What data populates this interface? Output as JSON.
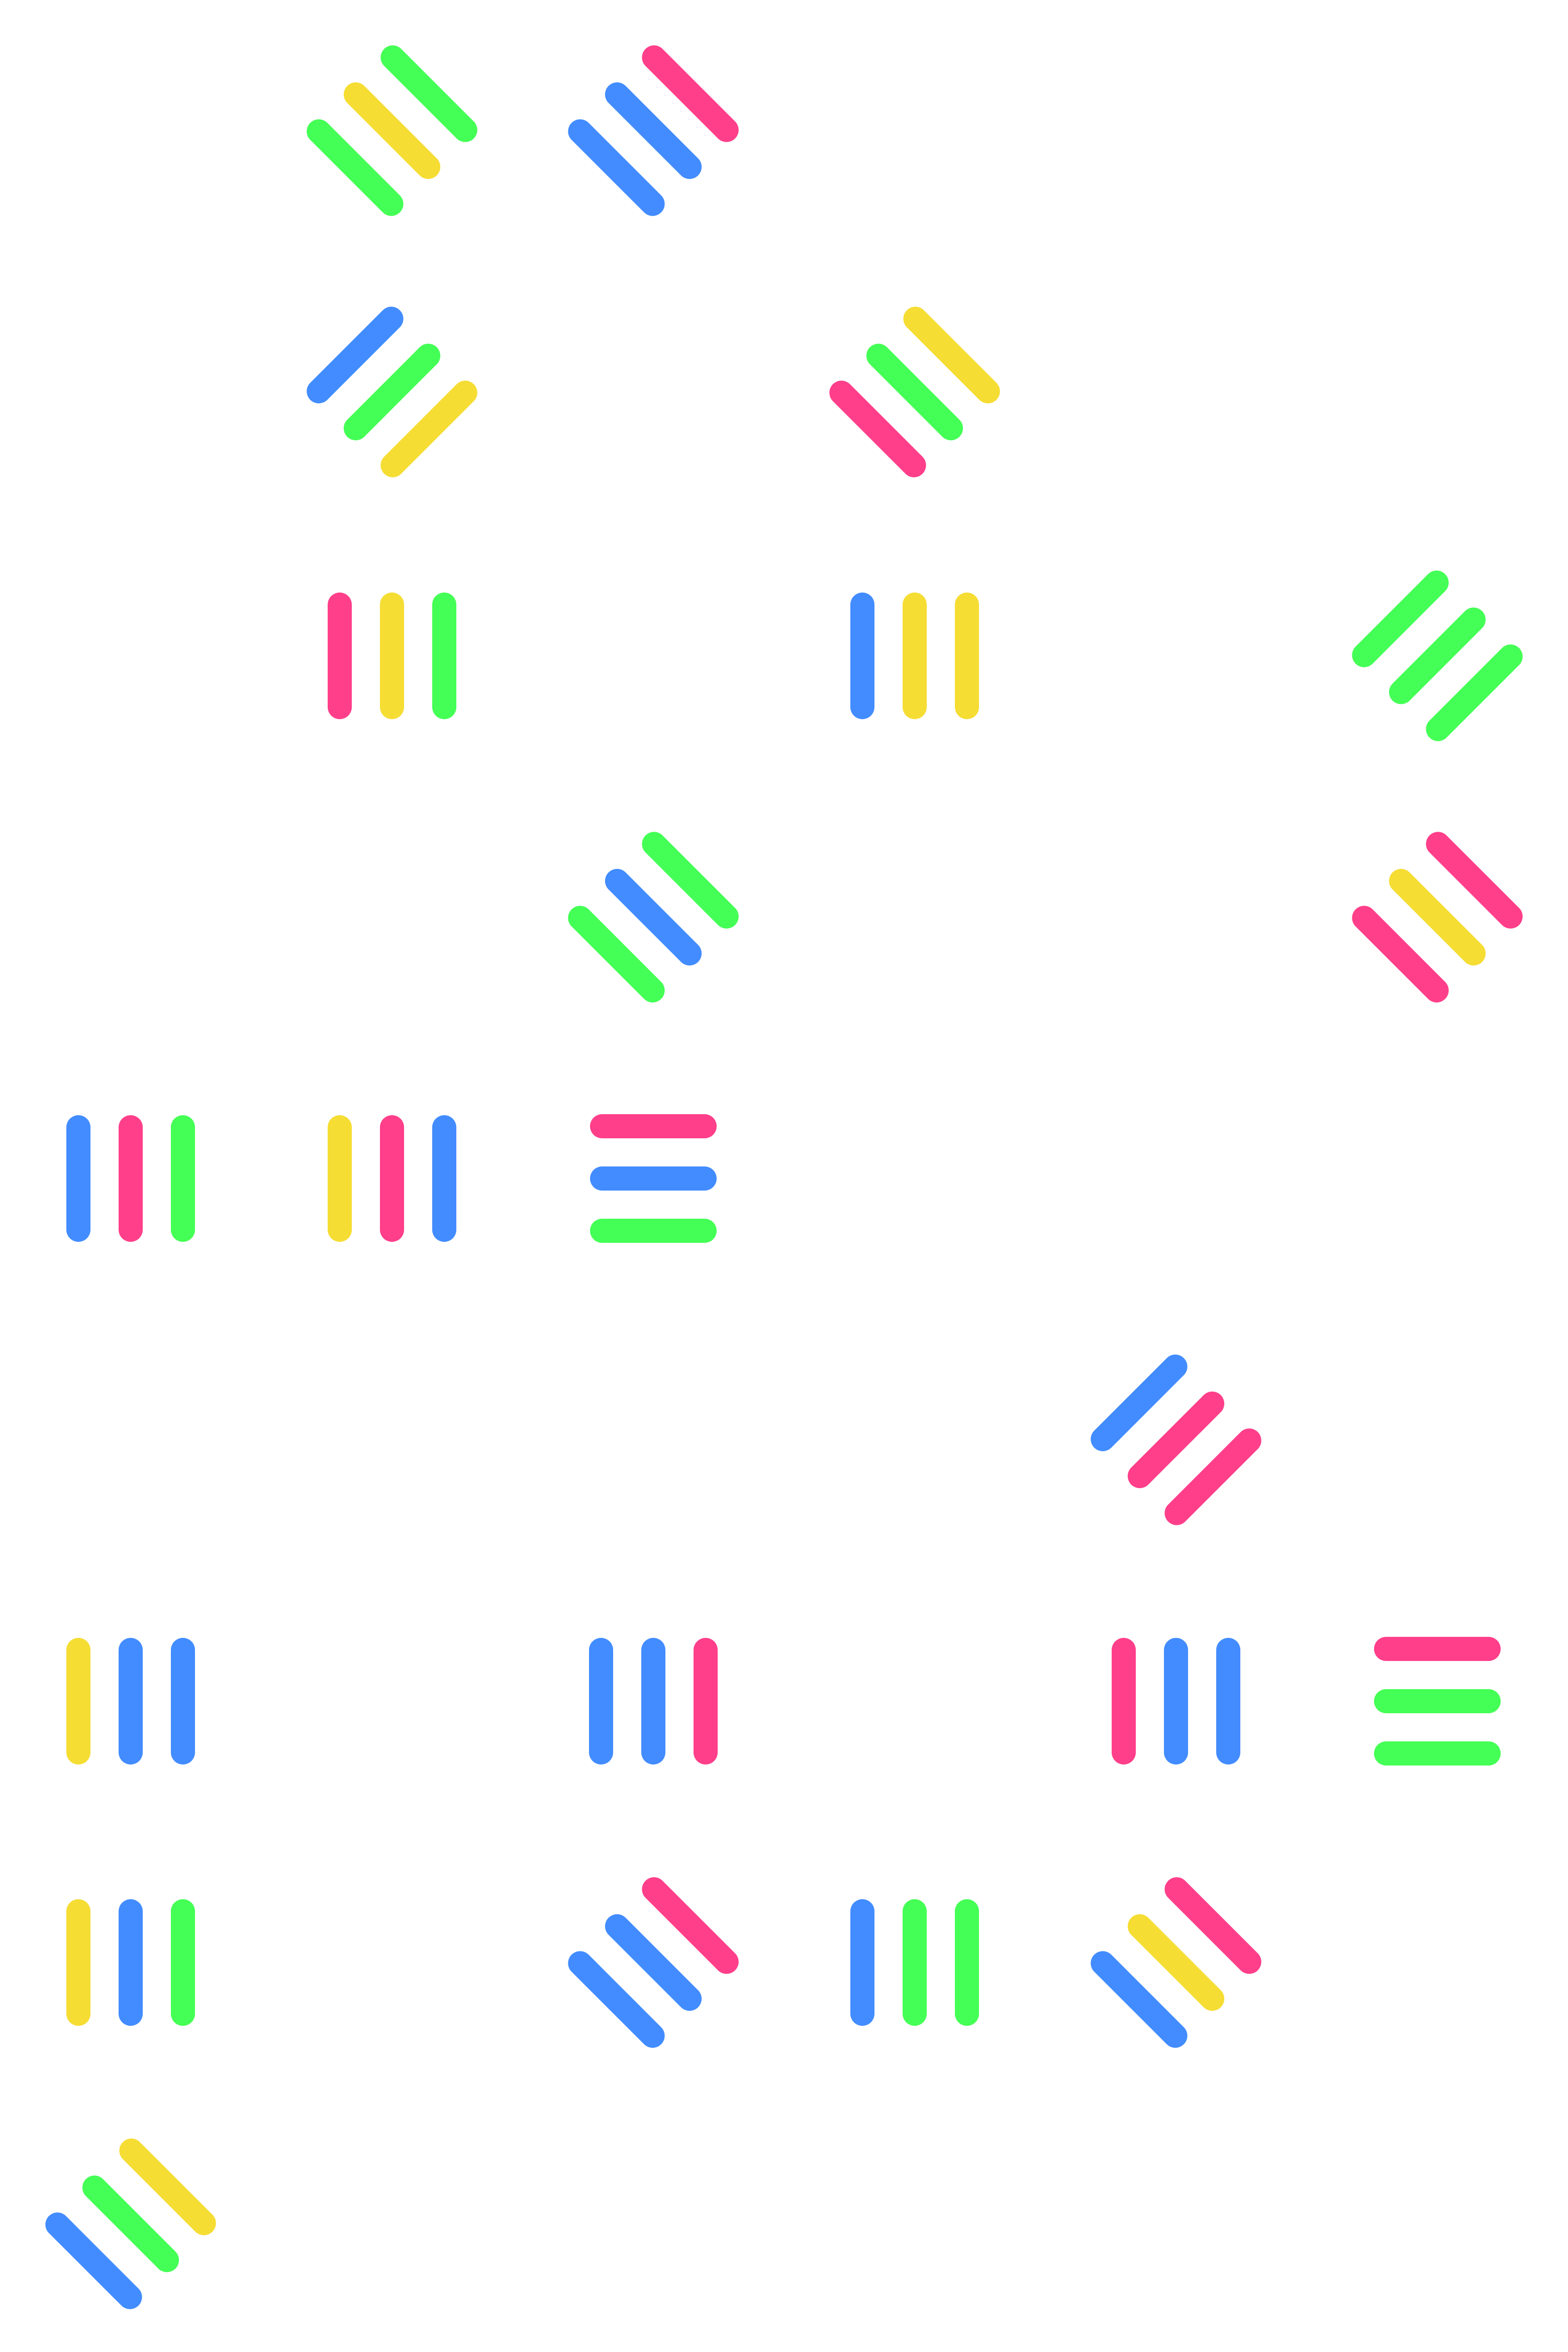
{
  "colors": {
    "pink": "#ff3f8a",
    "yellow": "#f5dd33",
    "green": "#44ff55",
    "blue": "#428cff"
  },
  "glyphs": [
    {
      "name": "glyph-r1c2",
      "orientation": "diagonal-down",
      "bars": [
        "green",
        "yellow",
        "green"
      ]
    },
    {
      "name": "glyph-r1c3",
      "orientation": "diagonal-down",
      "bars": [
        "blue",
        "blue",
        "pink"
      ]
    },
    {
      "name": "glyph-r2c2",
      "orientation": "diagonal-up",
      "bars": [
        "blue",
        "green",
        "yellow"
      ]
    },
    {
      "name": "glyph-r2c4",
      "orientation": "diagonal-down",
      "bars": [
        "pink",
        "green",
        "yellow"
      ]
    },
    {
      "name": "glyph-r3c2",
      "orientation": "vertical",
      "bars": [
        "pink",
        "yellow",
        "green"
      ]
    },
    {
      "name": "glyph-r3c4",
      "orientation": "vertical",
      "bars": [
        "blue",
        "yellow",
        "yellow"
      ]
    },
    {
      "name": "glyph-r3c6",
      "orientation": "diagonal-up",
      "bars": [
        "green",
        "green",
        "green"
      ]
    },
    {
      "name": "glyph-r4c3",
      "orientation": "diagonal-down",
      "bars": [
        "green",
        "blue",
        "green"
      ]
    },
    {
      "name": "glyph-r4c6",
      "orientation": "diagonal-down",
      "bars": [
        "pink",
        "yellow",
        "pink"
      ]
    },
    {
      "name": "glyph-r5c1",
      "orientation": "vertical",
      "bars": [
        "blue",
        "pink",
        "green"
      ]
    },
    {
      "name": "glyph-r5c2",
      "orientation": "vertical",
      "bars": [
        "yellow",
        "pink",
        "blue"
      ]
    },
    {
      "name": "glyph-r5c3",
      "orientation": "horizontal",
      "bars": [
        "pink",
        "blue",
        "green"
      ]
    },
    {
      "name": "glyph-r6c5",
      "orientation": "diagonal-up",
      "bars": [
        "blue",
        "pink",
        "pink"
      ]
    },
    {
      "name": "glyph-r7c1",
      "orientation": "vertical",
      "bars": [
        "yellow",
        "blue",
        "blue"
      ]
    },
    {
      "name": "glyph-r7c3",
      "orientation": "vertical",
      "bars": [
        "blue",
        "blue",
        "pink"
      ]
    },
    {
      "name": "glyph-r7c5",
      "orientation": "vertical",
      "bars": [
        "pink",
        "blue",
        "blue"
      ]
    },
    {
      "name": "glyph-r7c6",
      "orientation": "horizontal",
      "bars": [
        "pink",
        "green",
        "green"
      ]
    },
    {
      "name": "glyph-r8c1",
      "orientation": "vertical",
      "bars": [
        "yellow",
        "blue",
        "green"
      ]
    },
    {
      "name": "glyph-r8c3",
      "orientation": "diagonal-down",
      "bars": [
        "blue",
        "blue",
        "pink"
      ]
    },
    {
      "name": "glyph-r8c4",
      "orientation": "vertical",
      "bars": [
        "blue",
        "green",
        "green"
      ]
    },
    {
      "name": "glyph-r8c5",
      "orientation": "diagonal-down",
      "bars": [
        "blue",
        "yellow",
        "pink"
      ]
    },
    {
      "name": "glyph-r9c1",
      "orientation": "diagonal-down",
      "bars": [
        "blue",
        "green",
        "yellow"
      ]
    }
  ]
}
